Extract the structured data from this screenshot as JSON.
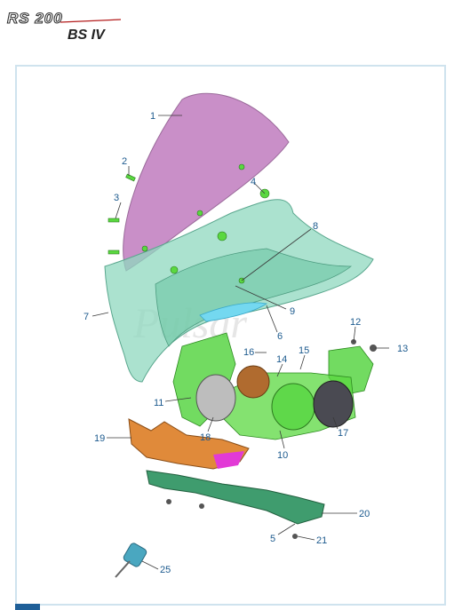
{
  "header": {
    "model_logo": "RS 200",
    "variant": "BS IV"
  },
  "callouts": [
    {
      "number": "1"
    },
    {
      "number": "2"
    },
    {
      "number": "3"
    },
    {
      "number": "4"
    },
    {
      "number": "5"
    },
    {
      "number": "6"
    },
    {
      "number": "7"
    },
    {
      "number": "8"
    },
    {
      "number": "9"
    },
    {
      "number": "10"
    },
    {
      "number": "11"
    },
    {
      "number": "12"
    },
    {
      "number": "13"
    },
    {
      "number": "14"
    },
    {
      "number": "15"
    },
    {
      "number": "16"
    },
    {
      "number": "17"
    },
    {
      "number": "18"
    },
    {
      "number": "19"
    },
    {
      "number": "20"
    },
    {
      "number": "21"
    },
    {
      "number": "25"
    }
  ],
  "colors": {
    "windscreen": "#c98fc8",
    "fairing": "#8fd8bf",
    "bracket": "#4fd23a",
    "lower_cover": "#e08a3a",
    "bottom_panel": "#3f9c6e",
    "callout_text": "#1c5a8e",
    "frame_border": "#cfe3ee"
  }
}
